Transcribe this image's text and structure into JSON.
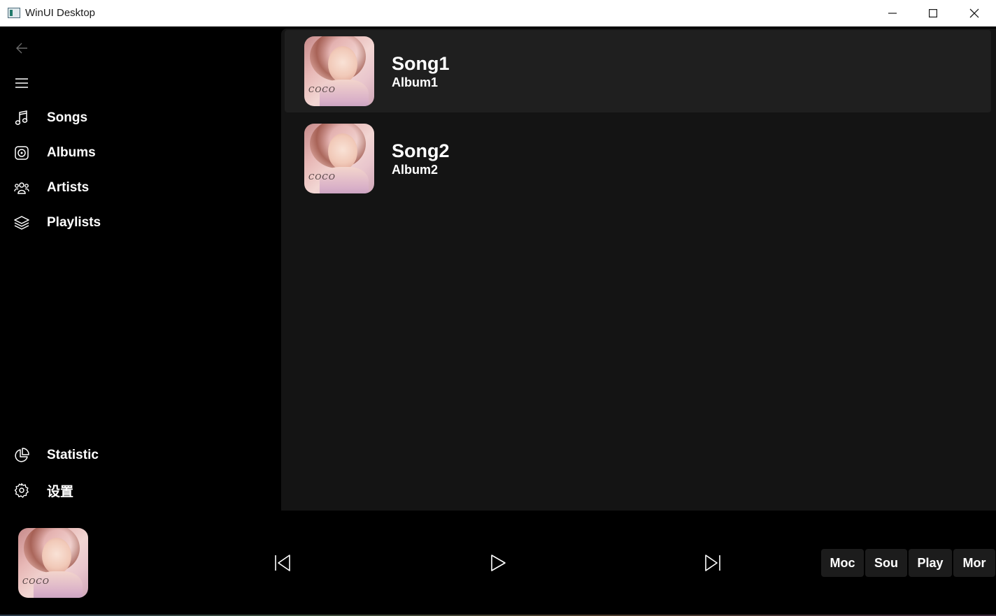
{
  "window": {
    "title": "WinUI Desktop"
  },
  "sidebar": {
    "items": [
      {
        "label": "Songs",
        "icon": "music-note-icon"
      },
      {
        "label": "Albums",
        "icon": "album-icon"
      },
      {
        "label": "Artists",
        "icon": "people-icon"
      },
      {
        "label": "Playlists",
        "icon": "layers-icon"
      }
    ],
    "footer_items": [
      {
        "label": "Statistic",
        "icon": "pie-chart-icon"
      },
      {
        "label": "设置",
        "icon": "gear-icon"
      }
    ]
  },
  "songs": [
    {
      "title": "Song1",
      "album": "Album1",
      "selected": true
    },
    {
      "title": "Song2",
      "album": "Album2",
      "selected": false
    }
  ],
  "cover_art": {
    "text": "COCO"
  },
  "player": {
    "chips": [
      "Moc",
      "Sou",
      "Play",
      "Mor"
    ]
  },
  "colors": {
    "background": "#000000",
    "content": "#141414",
    "selected_row": "#1f1f1f",
    "chip": "#1c1c1c",
    "text": "#ffffff"
  }
}
